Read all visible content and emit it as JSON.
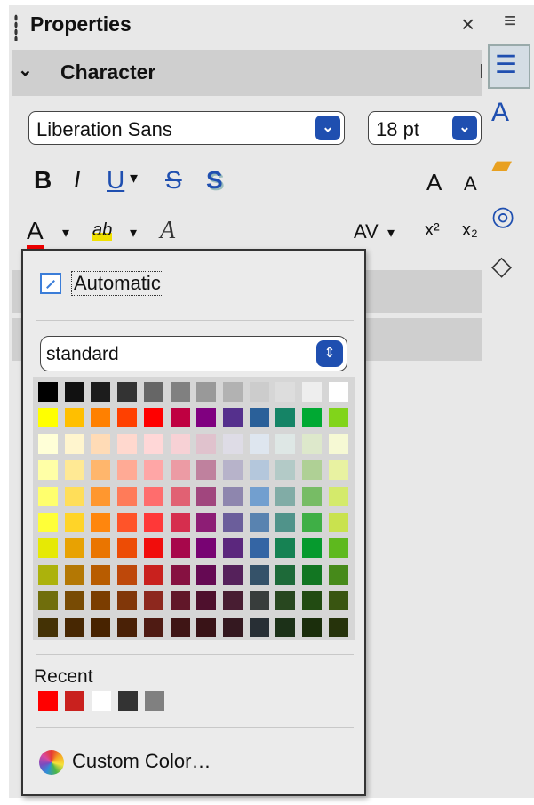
{
  "header": {
    "title": "Properties",
    "close_glyph": "×",
    "menu_glyph": "≡"
  },
  "section": {
    "title": "Character",
    "chevron": "⌄"
  },
  "font_name": {
    "value": "Liberation Sans",
    "arrow": "⌄"
  },
  "font_size": {
    "value": "18 pt",
    "arrow": "⌄"
  },
  "format": {
    "bold": "B",
    "italic": "I",
    "underline": "U",
    "strikethrough": "S",
    "shadow": "S",
    "grow": "A",
    "shrink": "A",
    "dropdown_arrow": "▾",
    "font_color": "A",
    "highlight": "ab",
    "clear_format": "A",
    "spacing": "AV",
    "superscript": "x²",
    "subscript": "x₂"
  },
  "popup": {
    "automatic_label": "Automatic",
    "palette_name": "standard",
    "palette_arrow": "⇕",
    "colors": [
      [
        "#000000",
        "#111111",
        "#1c1c1c",
        "#333333",
        "#666666",
        "#808080",
        "#999999",
        "#b2b2b2",
        "#cccccc",
        "#dddddd",
        "#eeeeee",
        "#ffffff"
      ],
      [
        "#ffff00",
        "#ffbf00",
        "#ff8000",
        "#ff4000",
        "#ff0000",
        "#bf0041",
        "#800080",
        "#55308d",
        "#2a6099",
        "#158466",
        "#00a933",
        "#81d41a"
      ],
      [
        "#ffffd7",
        "#fff5ce",
        "#ffdbb6",
        "#ffd8ce",
        "#ffd7d7",
        "#f7d1d5",
        "#e0c2cd",
        "#dedce6",
        "#dee6ef",
        "#dee7e5",
        "#dde8cb",
        "#f6f9d4"
      ],
      [
        "#ffffa6",
        "#ffe994",
        "#ffb66c",
        "#ffaa95",
        "#ffa6a6",
        "#ec9ba4",
        "#bf819e",
        "#b7b3ca",
        "#b4c7dc",
        "#b3cac7",
        "#afd095",
        "#e8f2a1"
      ],
      [
        "#ffff6d",
        "#ffde59",
        "#ff972f",
        "#ff7b59",
        "#ff6d6d",
        "#e16173",
        "#a1467e",
        "#8e86ae",
        "#729fcf",
        "#81aca6",
        "#77bc65",
        "#d4ea6b"
      ],
      [
        "#ffff38",
        "#ffd428",
        "#ff860d",
        "#ff5429",
        "#ff3838",
        "#d62e4e",
        "#8d1d75",
        "#6b5e9b",
        "#5983b0",
        "#50938a",
        "#3faf46",
        "#c9e24e"
      ],
      [
        "#e6e905",
        "#e8a202",
        "#ea7500",
        "#ed4c05",
        "#f10d0c",
        "#a7074b",
        "#780373",
        "#5b277d",
        "#3465a4",
        "#168253",
        "#069a2e",
        "#5eb91e"
      ],
      [
        "#acb20c",
        "#b47804",
        "#b85c00",
        "#be480a",
        "#c9211e",
        "#861141",
        "#650953",
        "#55215b",
        "#355269",
        "#1e6a39",
        "#127622",
        "#468a1a"
      ],
      [
        "#706e0c",
        "#784b04",
        "#7b3d00",
        "#813709",
        "#8d281e",
        "#611729",
        "#4e102d",
        "#481d32",
        "#383d3c",
        "#28471f",
        "#224b12",
        "#395511"
      ],
      [
        "#443205",
        "#472702",
        "#482300",
        "#4a2106",
        "#4f1b13",
        "#3f1515",
        "#391317",
        "#341820",
        "#282f35",
        "#1c3118",
        "#1b2e0c",
        "#26330b"
      ]
    ],
    "recent_label": "Recent",
    "recent_colors": [
      "#ff0000",
      "#c9211e",
      "#ffffff",
      "#333333",
      "#808080"
    ],
    "custom_label": "Custom Color…"
  },
  "tabs": [
    "properties-icon",
    "styles-icon",
    "gallery-icon",
    "navigator-icon",
    "shapes-icon"
  ]
}
